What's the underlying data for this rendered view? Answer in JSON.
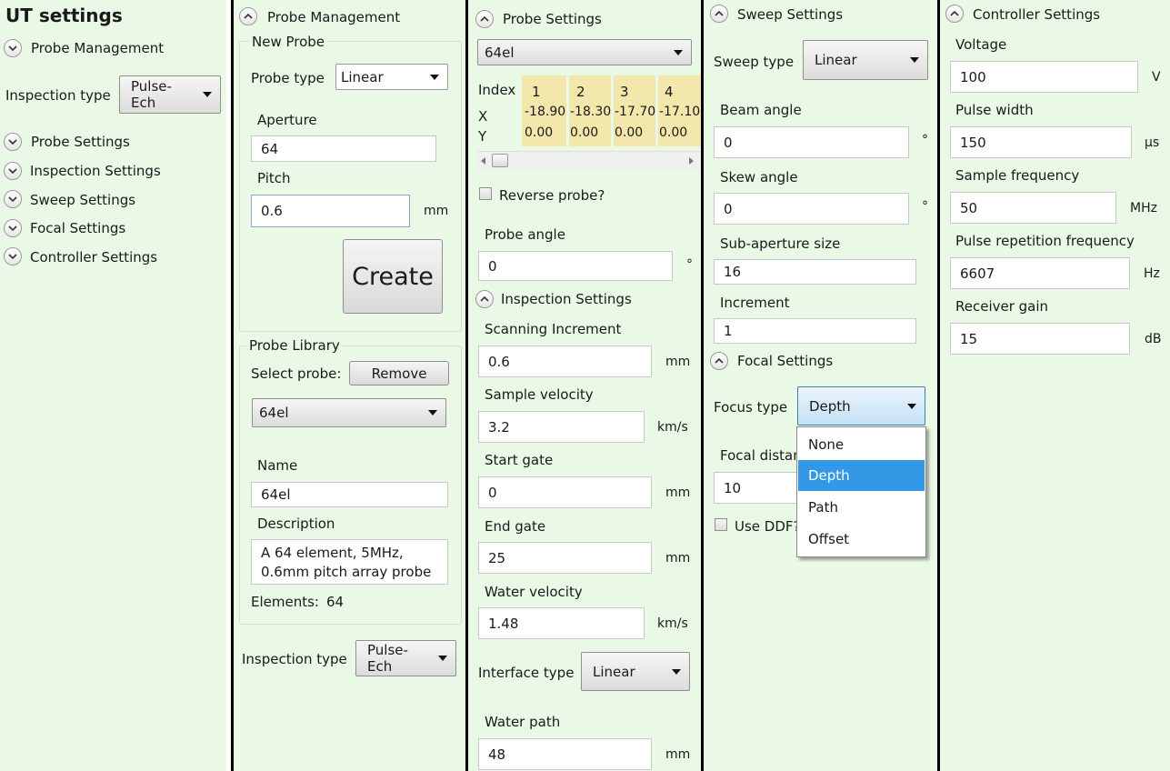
{
  "p1": {
    "title": "UT settings",
    "probe_management": "Probe Management",
    "inspection_type_label": "Inspection type",
    "inspection_type_value": "Pulse-Ech",
    "probe_settings": "Probe Settings",
    "inspection_settings": "Inspection Settings",
    "sweep_settings": "Sweep Settings",
    "focal_settings": "Focal Settings",
    "controller_settings": "Controller Settings"
  },
  "p2": {
    "header": "Probe Management",
    "new_probe": "New Probe",
    "probe_type_label": "Probe type",
    "probe_type_value": "Linear",
    "aperture_label": "Aperture",
    "aperture_value": "64",
    "pitch_label": "Pitch",
    "pitch_value": "0.6",
    "pitch_unit": "mm",
    "create": "Create",
    "probe_library": "Probe Library",
    "select_probe_label": "Select probe:",
    "remove": "Remove",
    "select_probe_value": "64el",
    "name_label": "Name",
    "name_value": "64el",
    "description_label": "Description",
    "description_line1": "A 64 element, 5MHz,",
    "description_line2": "0.6mm pitch array probe",
    "elements_label": "Elements:",
    "elements_value": "64",
    "inspection_type_label": "Inspection type",
    "inspection_type_value": "Pulse-Ech"
  },
  "p3": {
    "header": "Probe Settings",
    "probe_select": "64el",
    "grid": {
      "index_label": "Index",
      "x_label": "X",
      "y_label": "Y",
      "columns": [
        {
          "index": "1",
          "x": "-18.90",
          "y": "0.00"
        },
        {
          "index": "2",
          "x": "-18.30",
          "y": "0.00"
        },
        {
          "index": "3",
          "x": "-17.70",
          "y": "0.00"
        },
        {
          "index": "4",
          "x": "-17.10",
          "y": "0.00"
        }
      ]
    },
    "reverse_probe": "Reverse probe?",
    "probe_angle_label": "Probe angle",
    "probe_angle_value": "0",
    "probe_angle_unit": "°",
    "inspection_header": "Inspection Settings",
    "scan_inc_label": "Scanning Increment",
    "scan_inc_value": "0.6",
    "scan_inc_unit": "mm",
    "sample_vel_label": "Sample velocity",
    "sample_vel_value": "3.2",
    "sample_vel_unit": "km/s",
    "start_gate_label": "Start gate",
    "start_gate_value": "0",
    "start_gate_unit": "mm",
    "end_gate_label": "End gate",
    "end_gate_value": "25",
    "end_gate_unit": "mm",
    "water_vel_label": "Water velocity",
    "water_vel_value": "1.48",
    "water_vel_unit": "km/s",
    "interface_label": "Interface type",
    "interface_value": "Linear",
    "water_path_label": "Water path",
    "water_path_value": "48",
    "water_path_unit": "mm"
  },
  "p4": {
    "header": "Sweep Settings",
    "sweep_type_label": "Sweep type",
    "sweep_type_value": "Linear",
    "beam_angle_label": "Beam angle",
    "beam_angle_value": "0",
    "beam_angle_unit": "°",
    "skew_angle_label": "Skew angle",
    "skew_angle_value": "0",
    "skew_angle_unit": "°",
    "subap_label": "Sub-aperture size",
    "subap_value": "16",
    "increment_label": "Increment",
    "increment_value": "1",
    "focal_header": "Focal Settings",
    "focus_type_label": "Focus type",
    "focus_type_value": "Depth",
    "focal_distance_label": "Focal distan",
    "focal_distance_value": "10",
    "use_ddf": "Use DDF?",
    "focus_options": [
      "None",
      "Depth",
      "Path",
      "Offset"
    ]
  },
  "p5": {
    "header": "Controller Settings",
    "voltage_label": "Voltage",
    "voltage_value": "100",
    "voltage_unit": "V",
    "pulse_width_label": "Pulse width",
    "pulse_width_value": "150",
    "pulse_width_unit": "µs",
    "sample_freq_label": "Sample frequency",
    "sample_freq_value": "50",
    "sample_freq_unit": "MHz",
    "prf_label": "Pulse repetition frequency",
    "prf_value": "6607",
    "prf_unit": "Hz",
    "gain_label": "Receiver gain",
    "gain_value": "15",
    "gain_unit": "dB"
  },
  "colors": {
    "panel_bg": "#eaf8e6",
    "grid_cell": "#f3e7ac",
    "selection": "#3399e6",
    "separator": "#000000"
  }
}
